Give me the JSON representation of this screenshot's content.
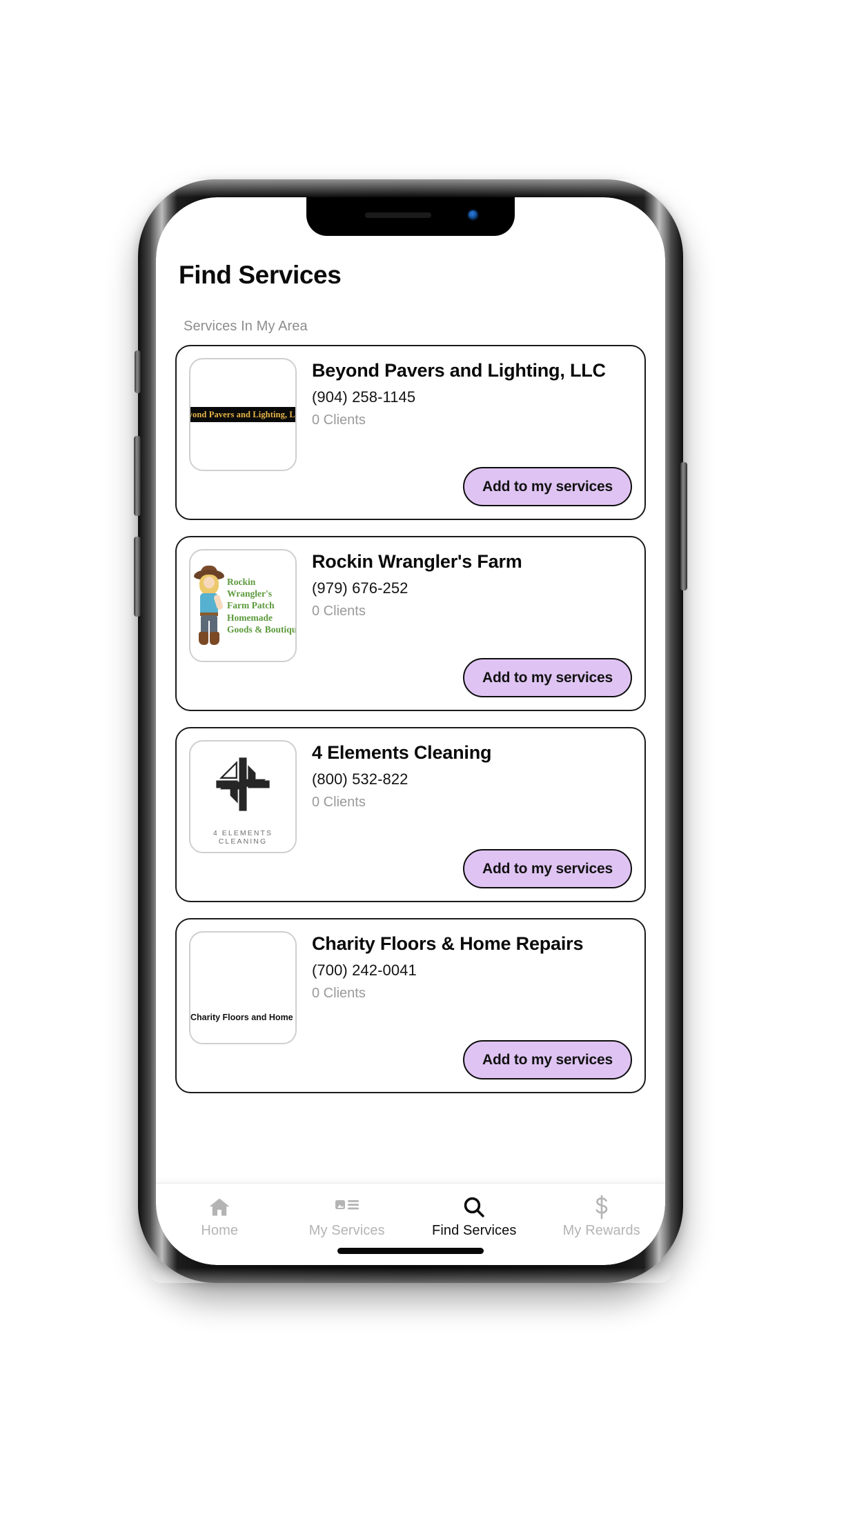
{
  "screen": {
    "page_title": "Find Services",
    "subtitle": "Services In My Area",
    "accent_button_color": "#dfc4f3",
    "border_color": "#1a1a1a"
  },
  "services": [
    {
      "name": "Beyond Pavers and Lighting, LLC",
      "phone": "(904) 258-1145",
      "clients": "0 Clients",
      "button_label": "Add to my services",
      "logo_type": "beyond-pavers",
      "logo_text": "Beyond Pavers and Lighting, LLC",
      "logo_text_color": "#e8b548",
      "logo_bg_color": "#0a0a0a"
    },
    {
      "name": "Rockin Wrangler's Farm",
      "phone": "(979) 676-252",
      "clients": "0 Clients",
      "button_label": "Add to my services",
      "logo_type": "rockin-wrangler",
      "logo_lines": [
        "Rockin",
        "Wrangler's",
        "Farm Patch",
        "Homemade",
        "Goods & Boutique"
      ],
      "logo_text_color": "#5c9a3c"
    },
    {
      "name": "4 Elements Cleaning",
      "phone": "(800) 532-822",
      "clients": "0 Clients",
      "button_label": "Add to my services",
      "logo_type": "four-elements",
      "logo_caption": "4 ELEMENTS CLEANING",
      "logo_mark_color": "#262626"
    },
    {
      "name": "Charity Floors & Home Repairs",
      "phone": "(700) 242-0041",
      "clients": "0 Clients",
      "button_label": "Add to my services",
      "logo_type": "charity-floors",
      "logo_text": "Charity Floors and Home Repairs",
      "logo_text_color": "#111111"
    }
  ],
  "tabbar": {
    "items": [
      {
        "label": "Home",
        "icon": "home-icon",
        "active": false
      },
      {
        "label": "My Services",
        "icon": "list-image-icon",
        "active": false
      },
      {
        "label": "Find Services",
        "icon": "search-icon",
        "active": true
      },
      {
        "label": "My Rewards",
        "icon": "dollar-icon",
        "active": false
      }
    ]
  }
}
